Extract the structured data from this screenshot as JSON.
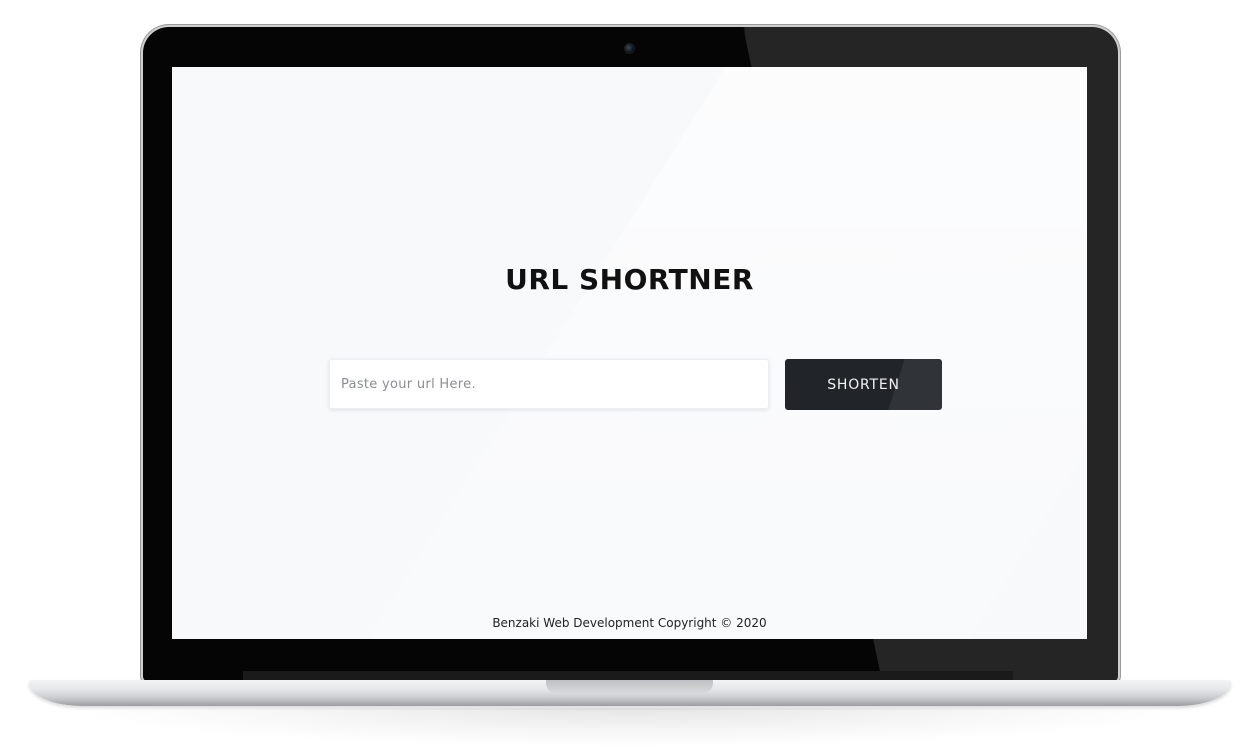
{
  "app": {
    "title": "URL SHORTNER"
  },
  "form": {
    "url_placeholder": "Paste your url Here.",
    "url_value": "",
    "submit_label": "SHORTEN"
  },
  "footer": {
    "text": "Benzaki Web Development Copyright © 2020"
  },
  "colors": {
    "screen_background": "#f8f9fb",
    "button_background": "#212529",
    "button_text": "#f1f3f5",
    "title_text": "#111111"
  }
}
